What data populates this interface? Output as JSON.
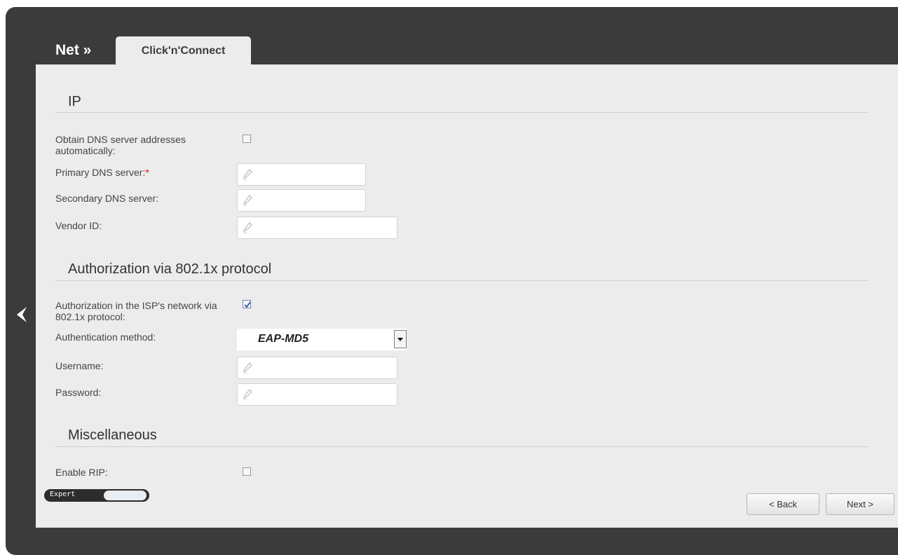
{
  "header": {
    "breadcrumb": "Net »",
    "tab_label": "Click'n'Connect"
  },
  "sections": {
    "ip": {
      "title": "IP",
      "obtain_dns_label_line1": "Obtain DNS server addresses",
      "obtain_dns_label_line2": "automatically:",
      "obtain_dns_checked": false,
      "primary_dns_label": "Primary DNS server:",
      "required_mark": "*",
      "primary_dns_value": "",
      "secondary_dns_label": "Secondary DNS server:",
      "secondary_dns_value": "",
      "vendor_id_label": "Vendor ID:",
      "vendor_id_value": ""
    },
    "auth": {
      "title": "Authorization via 802.1x protocol",
      "enable_label_line1": "Authorization in the ISP's network via",
      "enable_label_line2": "802.1x protocol:",
      "enable_checked": true,
      "method_label": "Authentication method:",
      "method_value": "EAP-MD5",
      "username_label": "Username:",
      "username_value": "",
      "password_label": "Password:",
      "password_value": ""
    },
    "misc": {
      "title": "Miscellaneous",
      "enable_rip_label": "Enable RIP:",
      "enable_rip_checked": false
    }
  },
  "footer": {
    "expert_label": "Expert",
    "back_button": "< Back",
    "next_button": "Next >"
  },
  "icons": {
    "back_arrow": "chevron-left-icon",
    "field_icon": "pencil-icon",
    "dropdown": "caret-down-icon"
  },
  "colors": {
    "frame": "#3b3b3b",
    "panel": "#ececec",
    "required": "#ff0000"
  }
}
